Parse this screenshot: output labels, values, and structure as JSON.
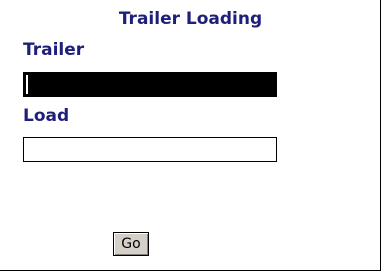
{
  "header": {
    "title": "Trailer Loading"
  },
  "form": {
    "trailer": {
      "label": "Trailer",
      "value": ""
    },
    "load": {
      "label": "Load",
      "value": ""
    },
    "submit_label": "Go"
  },
  "colors": {
    "label_text": "#1f1f7a",
    "focused_field_background": "#000000",
    "button_face": "#d4d0c8"
  }
}
